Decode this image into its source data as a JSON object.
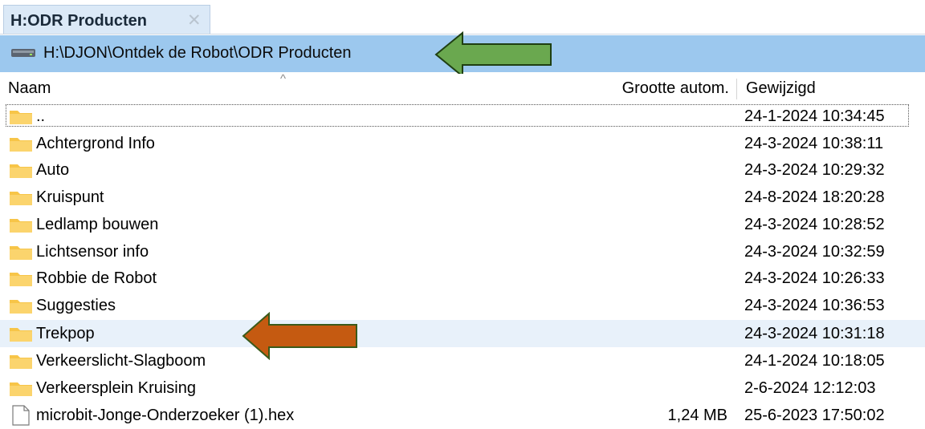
{
  "tab": {
    "title": "H:ODR Producten",
    "close_glyph": "✕"
  },
  "pathbar": {
    "path": "H:\\DJON\\Ontdek de Robot\\ODR Producten",
    "icon": "drive-icon"
  },
  "columns": {
    "name": "Naam",
    "size": "Grootte autom.",
    "modified": "Gewijzigd",
    "sort_glyph": "^"
  },
  "rows": [
    {
      "type": "folder",
      "name": "..",
      "size": "",
      "modified": "24-1-2024 10:34:45"
    },
    {
      "type": "folder",
      "name": "Achtergrond Info",
      "size": "",
      "modified": "24-3-2024 10:38:11"
    },
    {
      "type": "folder",
      "name": "Auto",
      "size": "",
      "modified": "24-3-2024 10:29:32"
    },
    {
      "type": "folder",
      "name": "Kruispunt",
      "size": "",
      "modified": "24-8-2024 18:20:28"
    },
    {
      "type": "folder",
      "name": "Ledlamp bouwen",
      "size": "",
      "modified": "24-3-2024 10:28:52"
    },
    {
      "type": "folder",
      "name": "Lichtsensor info",
      "size": "",
      "modified": "24-3-2024 10:32:59"
    },
    {
      "type": "folder",
      "name": "Robbie de Robot",
      "size": "",
      "modified": "24-3-2024 10:26:33"
    },
    {
      "type": "folder",
      "name": "Suggesties",
      "size": "",
      "modified": "24-3-2024 10:36:53"
    },
    {
      "type": "folder",
      "name": "Trekpop",
      "size": "",
      "modified": "24-3-2024 10:31:18"
    },
    {
      "type": "folder",
      "name": "Verkeerslicht-Slagboom",
      "size": "",
      "modified": "24-1-2024 10:18:05"
    },
    {
      "type": "folder",
      "name": "Verkeersplein Kruising",
      "size": "",
      "modified": "2-6-2024 12:12:03"
    },
    {
      "type": "file",
      "name": "microbit-Jonge-Onderzoeker (1).hex",
      "size": "1,24 MB",
      "modified": "25-6-2023 17:50:02"
    }
  ],
  "selected_row": "Trekpop",
  "colors": {
    "pathbar": "#9cc8ee",
    "tab": "#dbe9f7",
    "folder": "#f7c548",
    "arrow_green": "#6aa84f",
    "arrow_orange": "#c55a11"
  }
}
